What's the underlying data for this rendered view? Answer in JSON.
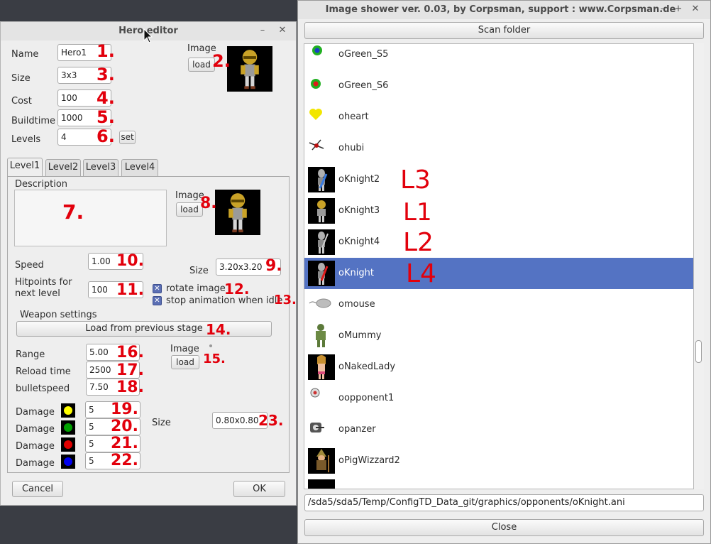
{
  "hero_editor": {
    "title": "Hero editor",
    "minimize": "–",
    "close": "✕",
    "name_label": "Name",
    "name_value": "Hero1",
    "size_label": "Size",
    "size_value": "3x3",
    "cost_label": "Cost",
    "cost_value": "100",
    "buildtime_label": "Buildtime",
    "buildtime_value": "1000",
    "levels_label": "Levels",
    "levels_value": "4",
    "set_button": "set",
    "image_label": "Image",
    "load_button": "load",
    "tabs": [
      "Level1",
      "Level2",
      "Level3",
      "Level4"
    ],
    "level": {
      "description_label": "Description",
      "description_value": "",
      "image_label": "Image",
      "load_button": "load",
      "speed_label": "Speed",
      "speed_value": "1.00",
      "size_label": "Size",
      "size_value": "3.20x3.20",
      "hitpoints_label_1": "Hitpoints for",
      "hitpoints_label_2": "next level",
      "hitpoints_value": "100",
      "rotate_label": "rotate image",
      "stop_anim_label": "stop animation when idle",
      "weapon_settings_label": "Weapon settings",
      "load_prev_button": "Load from previous stage",
      "range_label": "Range",
      "range_value": "5.00",
      "reload_label": "Reload time",
      "reload_value": "2500",
      "bulletspeed_label": "bulletspeed",
      "bulletspeed_value": "7.50",
      "weapon_image_label": "Image",
      "weapon_load_button": "load",
      "damage_label": "Damage",
      "damages": [
        {
          "value": "5",
          "color": "#ffff00"
        },
        {
          "value": "5",
          "color": "#00a000"
        },
        {
          "value": "5",
          "color": "#e00000"
        },
        {
          "value": "5",
          "color": "#0000ee"
        }
      ],
      "bullet_size_label": "Size",
      "bullet_size_value": "0.80x0.80"
    },
    "cancel_button": "Cancel",
    "ok_button": "OK"
  },
  "image_shower": {
    "title": "Image shower ver. 0.03, by Corpsman, support : www.Corpsman.de",
    "minimize": "–",
    "maximize": "+",
    "close": "✕",
    "scan_button": "Scan folder",
    "items": [
      {
        "name": "oGreen_S5",
        "icon": "green-dot-icon"
      },
      {
        "name": "oGreen_S6",
        "icon": "green-dot-icon"
      },
      {
        "name": "oheart",
        "icon": "heart-icon"
      },
      {
        "name": "ohubi",
        "icon": "helicopter-icon"
      },
      {
        "name": "oKnight2",
        "icon": "knight-icon"
      },
      {
        "name": "oKnight3",
        "icon": "knight-icon"
      },
      {
        "name": "oKnight4",
        "icon": "knight-icon"
      },
      {
        "name": "oKnight",
        "icon": "knight-icon",
        "selected": true
      },
      {
        "name": "omouse",
        "icon": "mouse-icon"
      },
      {
        "name": "oMummy",
        "icon": "mummy-icon"
      },
      {
        "name": "oNakedLady",
        "icon": "lady-icon"
      },
      {
        "name": "oopponent1",
        "icon": "opponent-icon"
      },
      {
        "name": "opanzer",
        "icon": "tank-icon"
      },
      {
        "name": "oPigWizzard2",
        "icon": "wizard-icon"
      }
    ],
    "path_value": "/sda5/sda5/Temp/ConfigTD_Data_git/graphics/opponents/oKnight.ani",
    "close_button": "Close"
  },
  "annotations": {
    "n1": "1.",
    "n2": "2.",
    "n3": "3.",
    "n4": "4.",
    "n5": "5.",
    "n6": "6.",
    "n7": "7.",
    "n8": "8.",
    "n9": "9.",
    "n10": "10.",
    "n11": "11.",
    "n12": "12.",
    "n13": "13.",
    "n14": "14.",
    "n15": "15.",
    "n16": "16.",
    "n17": "17.",
    "n18": "18.",
    "n19": "19.",
    "n20": "20.",
    "n21": "21.",
    "n22": "22.",
    "n23": "23.",
    "l3": "L3",
    "l1": "L1",
    "l2": "L2",
    "l4": "L4"
  }
}
